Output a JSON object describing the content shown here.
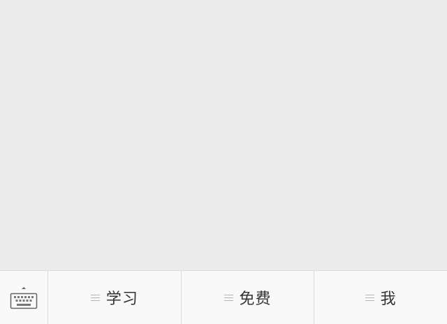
{
  "bottom_bar": {
    "keyboard_toggle": {
      "icon": "keyboard-icon"
    },
    "menus": [
      {
        "label": "学习",
        "icon": "menu-lines-icon"
      },
      {
        "label": "免费",
        "icon": "menu-lines-icon"
      },
      {
        "label": "我",
        "icon": "menu-lines-icon"
      }
    ]
  },
  "colors": {
    "content_background": "#ebebeb",
    "bar_background": "#f9f9f9",
    "divider": "#dcdcdc",
    "label_text": "#333333",
    "icon_gray": "#b4b4b4"
  }
}
